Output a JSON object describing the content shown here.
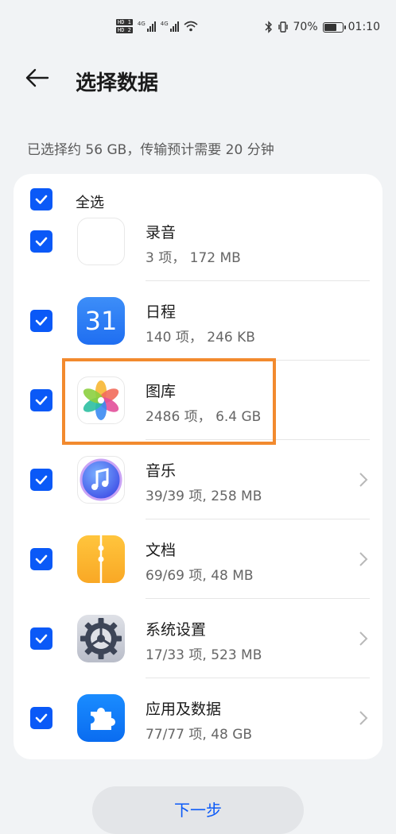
{
  "status_bar": {
    "hd1": "HD 1",
    "hd2": "HD 2",
    "net1": "4G",
    "net2": "4G",
    "battery": "70%",
    "battery_level": 0.7,
    "time": "01:10"
  },
  "header": {
    "title": "选择数据"
  },
  "summary": "已选择约 56 GB，传输预计需要 20 分钟",
  "select_all": {
    "label": "全选",
    "checked": true
  },
  "items": [
    {
      "title": "录音",
      "sub": "3 项， 172 MB",
      "icon": "recorder-icon",
      "checked": true,
      "has_chevron": false
    },
    {
      "title": "日程",
      "sub": "140 项， 246 KB",
      "icon": "calendar-icon",
      "icon_text": "31",
      "checked": true,
      "has_chevron": false
    },
    {
      "title": "图库",
      "sub": "2486 项， 6.4 GB",
      "icon": "gallery-icon",
      "checked": true,
      "has_chevron": false
    },
    {
      "title": "音乐",
      "sub": "39/39 项, 258 MB",
      "icon": "music-icon",
      "checked": true,
      "has_chevron": true
    },
    {
      "title": "文档",
      "sub": "69/69 项, 48 MB",
      "icon": "documents-icon",
      "checked": true,
      "has_chevron": true
    },
    {
      "title": "系统设置",
      "sub": "17/33 项, 523 MB",
      "icon": "settings-icon",
      "checked": true,
      "has_chevron": true
    },
    {
      "title": "应用及数据",
      "sub": "77/77 项, 48 GB",
      "icon": "apps-icon",
      "checked": true,
      "has_chevron": true
    }
  ],
  "next_button": "下一步",
  "colors": {
    "accent": "#0a59f7",
    "highlight": "#f28a2e",
    "background": "#f1f3f5"
  }
}
